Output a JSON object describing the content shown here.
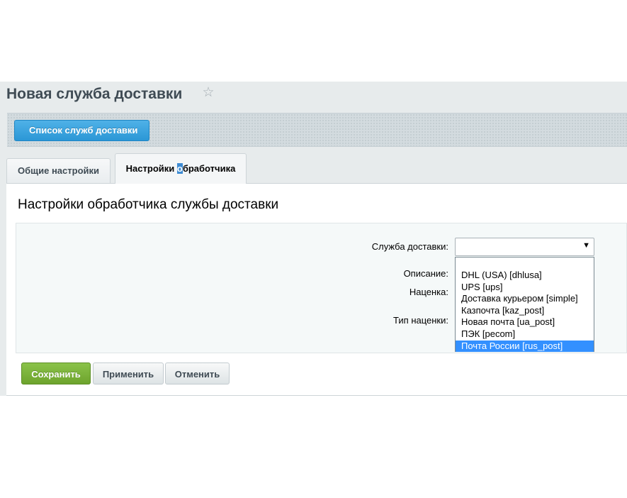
{
  "header": {
    "title": "Новая служба доставки",
    "star_icon": "star-icon"
  },
  "context_bar": {
    "back_label": "Список служб доставки"
  },
  "tabs": [
    {
      "label": "Общие настройки",
      "active": false
    },
    {
      "label_before": "Настройки ",
      "label_highlight": "о",
      "label_after": "бработчика",
      "active": true
    }
  ],
  "section": {
    "title": "Настройки обработчика службы доставки"
  },
  "form": {
    "service_label": "Служба доставки:",
    "service_value": "",
    "description_label": "Описание:",
    "markup_label": "Наценка:",
    "markup_type_label": "Тип наценки:"
  },
  "dropdown": {
    "options": [
      "DHL (USA) [dhlusa]",
      "UPS [ups]",
      "Доставка курьером [simple]",
      "Казпочта [kaz_post]",
      "Новая почта [ua_post]",
      "ПЭК [pecom]",
      "Почта России [rus_post]"
    ],
    "highlighted": "Почта России [rus_post]",
    "highlight_color": "#3390ff"
  },
  "buttons": {
    "save": "Сохранить",
    "apply": "Применить",
    "cancel": "Отменить",
    "save_color": "#7cb342"
  }
}
